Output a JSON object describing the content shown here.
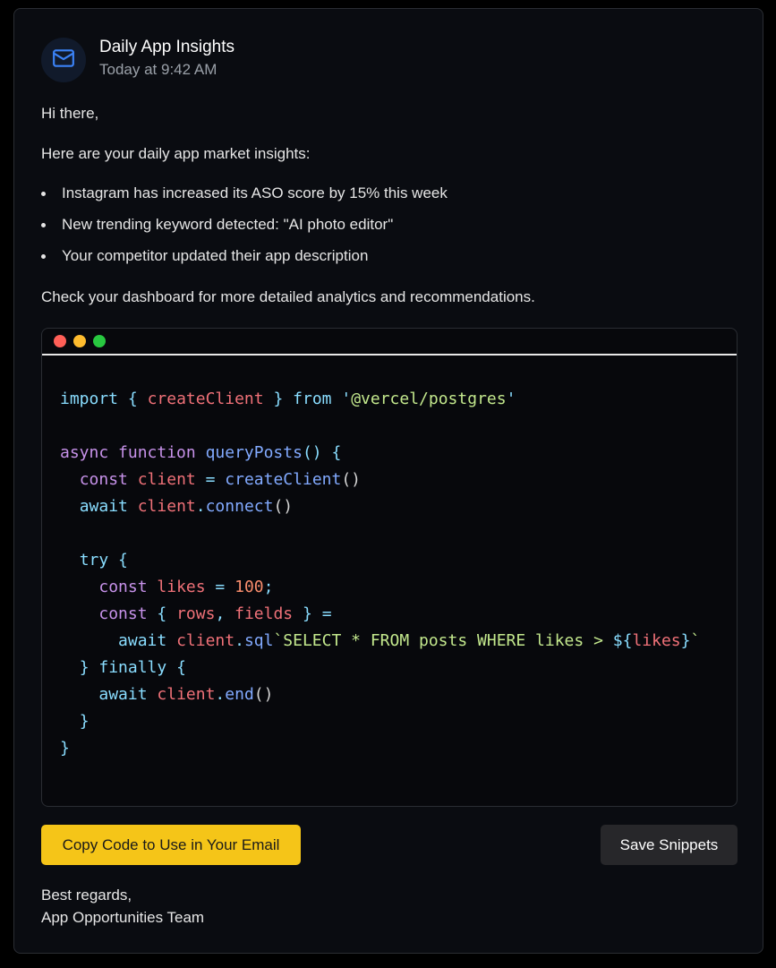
{
  "email": {
    "sender": "Daily App Insights",
    "time": "Today at 9:42 AM",
    "avatar_icon": "mail-icon",
    "greeting": "Hi there,",
    "intro": "Here are your daily app market insights:",
    "bullets": [
      "Instagram has increased its ASO score by 15% this week",
      "New trending keyword detected: \"AI photo editor\"",
      "Your competitor updated their app description"
    ],
    "closing_note": "Check your dashboard for more detailed analytics and recommendations.",
    "signoff_line1": "Best regards,",
    "signoff_line2": "App Opportunities Team"
  },
  "code_window": {
    "lights": [
      "#ff5f57",
      "#febc2e",
      "#28c840"
    ],
    "lines": [
      [
        [
          "kw2",
          "import"
        ],
        [
          "plain",
          " "
        ],
        [
          "punc",
          "{"
        ],
        [
          "plain",
          " "
        ],
        [
          "var",
          "createClient"
        ],
        [
          "plain",
          " "
        ],
        [
          "punc",
          "}"
        ],
        [
          "plain",
          " "
        ],
        [
          "kw2",
          "from"
        ],
        [
          "plain",
          " "
        ],
        [
          "punc",
          "'"
        ],
        [
          "str",
          "@vercel/postgres"
        ],
        [
          "punc",
          "'"
        ]
      ],
      [],
      [
        [
          "kw",
          "async"
        ],
        [
          "plain",
          " "
        ],
        [
          "kw",
          "function"
        ],
        [
          "plain",
          " "
        ],
        [
          "fn",
          "queryPosts"
        ],
        [
          "punc",
          "()"
        ],
        [
          "plain",
          " "
        ],
        [
          "punc",
          "{"
        ]
      ],
      [
        [
          "plain",
          "  "
        ],
        [
          "kw",
          "const"
        ],
        [
          "plain",
          " "
        ],
        [
          "var",
          "client"
        ],
        [
          "plain",
          " "
        ],
        [
          "punc",
          "="
        ],
        [
          "plain",
          " "
        ],
        [
          "fn",
          "createClient"
        ],
        [
          "plain",
          "()"
        ]
      ],
      [
        [
          "plain",
          "  "
        ],
        [
          "kw2",
          "await"
        ],
        [
          "plain",
          " "
        ],
        [
          "var",
          "client"
        ],
        [
          "punc",
          "."
        ],
        [
          "fn",
          "connect"
        ],
        [
          "plain",
          "()"
        ]
      ],
      [],
      [
        [
          "plain",
          "  "
        ],
        [
          "kw2",
          "try"
        ],
        [
          "plain",
          " "
        ],
        [
          "punc",
          "{"
        ]
      ],
      [
        [
          "plain",
          "    "
        ],
        [
          "kw",
          "const"
        ],
        [
          "plain",
          " "
        ],
        [
          "var",
          "likes"
        ],
        [
          "plain",
          " "
        ],
        [
          "punc",
          "="
        ],
        [
          "plain",
          " "
        ],
        [
          "num",
          "100"
        ],
        [
          "punc",
          ";"
        ]
      ],
      [
        [
          "plain",
          "    "
        ],
        [
          "kw",
          "const"
        ],
        [
          "plain",
          " "
        ],
        [
          "punc",
          "{"
        ],
        [
          "plain",
          " "
        ],
        [
          "var",
          "rows"
        ],
        [
          "punc",
          ","
        ],
        [
          "plain",
          " "
        ],
        [
          "var",
          "fields"
        ],
        [
          "plain",
          " "
        ],
        [
          "punc",
          "}"
        ],
        [
          "plain",
          " "
        ],
        [
          "punc",
          "="
        ]
      ],
      [
        [
          "plain",
          "      "
        ],
        [
          "kw2",
          "await"
        ],
        [
          "plain",
          " "
        ],
        [
          "var",
          "client"
        ],
        [
          "punc",
          "."
        ],
        [
          "fn",
          "sql"
        ],
        [
          "str",
          "`SELECT * FROM posts WHERE likes > "
        ],
        [
          "punc",
          "${"
        ],
        [
          "var",
          "likes"
        ],
        [
          "punc",
          "}"
        ],
        [
          "str",
          "`"
        ]
      ],
      [
        [
          "plain",
          "  "
        ],
        [
          "punc",
          "}"
        ],
        [
          "plain",
          " "
        ],
        [
          "kw2",
          "finally"
        ],
        [
          "plain",
          " "
        ],
        [
          "punc",
          "{"
        ]
      ],
      [
        [
          "plain",
          "    "
        ],
        [
          "kw2",
          "await"
        ],
        [
          "plain",
          " "
        ],
        [
          "var",
          "client"
        ],
        [
          "punc",
          "."
        ],
        [
          "fn",
          "end"
        ],
        [
          "plain",
          "()"
        ]
      ],
      [
        [
          "plain",
          "  "
        ],
        [
          "punc",
          "}"
        ]
      ],
      [
        [
          "punc",
          "}"
        ]
      ]
    ]
  },
  "actions": {
    "copy_label": "Copy Code to Use in Your Email",
    "save_label": "Save Snippets",
    "copy_color": "#f5c518",
    "save_color": "#27272a"
  }
}
